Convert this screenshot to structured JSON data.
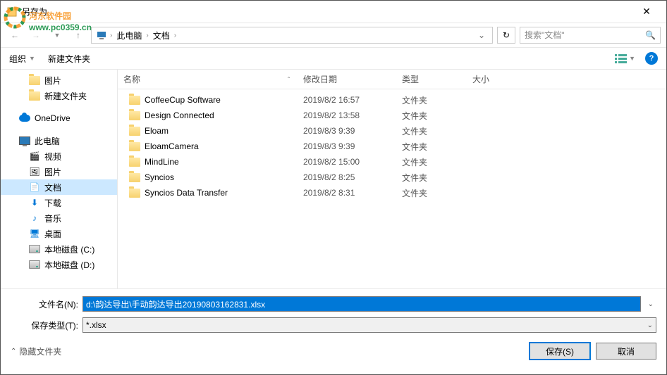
{
  "window": {
    "title": "另存为"
  },
  "watermark": {
    "text1": "河东软件园",
    "text2": "www.pc0359.cn",
    "color1": "#f7941d",
    "color2": "#0a8a3a"
  },
  "breadcrumb": {
    "seg1": "此电脑",
    "seg2": "文档"
  },
  "search": {
    "placeholder": "搜索\"文档\""
  },
  "toolbar": {
    "organize": "组织",
    "newfolder": "新建文件夹"
  },
  "sidebar": {
    "pictures": "图片",
    "newfolder": "新建文件夹",
    "onedrive": "OneDrive",
    "thispc": "此电脑",
    "videos": "视频",
    "pictures2": "图片",
    "documents": "文档",
    "downloads": "下载",
    "music": "音乐",
    "desktop": "桌面",
    "diskc": "本地磁盘 (C:)",
    "diskd": "本地磁盘 (D:)"
  },
  "columns": {
    "name": "名称",
    "date": "修改日期",
    "type": "类型",
    "size": "大小"
  },
  "files": [
    {
      "name": "CoffeeCup Software",
      "date": "2019/8/2 16:57",
      "type": "文件夹"
    },
    {
      "name": "Design Connected",
      "date": "2019/8/2 13:58",
      "type": "文件夹"
    },
    {
      "name": "Eloam",
      "date": "2019/8/3 9:39",
      "type": "文件夹"
    },
    {
      "name": "EloamCamera",
      "date": "2019/8/3 9:39",
      "type": "文件夹"
    },
    {
      "name": "MindLine",
      "date": "2019/8/2 15:00",
      "type": "文件夹"
    },
    {
      "name": "Syncios",
      "date": "2019/8/2 8:25",
      "type": "文件夹"
    },
    {
      "name": "Syncios Data Transfer",
      "date": "2019/8/2 8:31",
      "type": "文件夹"
    }
  ],
  "form": {
    "filename_label": "文件名(N):",
    "filename_value": "d:\\韵达导出\\手动韵达导出20190803162831.xlsx",
    "filetype_label": "保存类型(T):",
    "filetype_value": "*.xlsx"
  },
  "buttons": {
    "hidefolders": "隐藏文件夹",
    "save": "保存(S)",
    "cancel": "取消"
  }
}
